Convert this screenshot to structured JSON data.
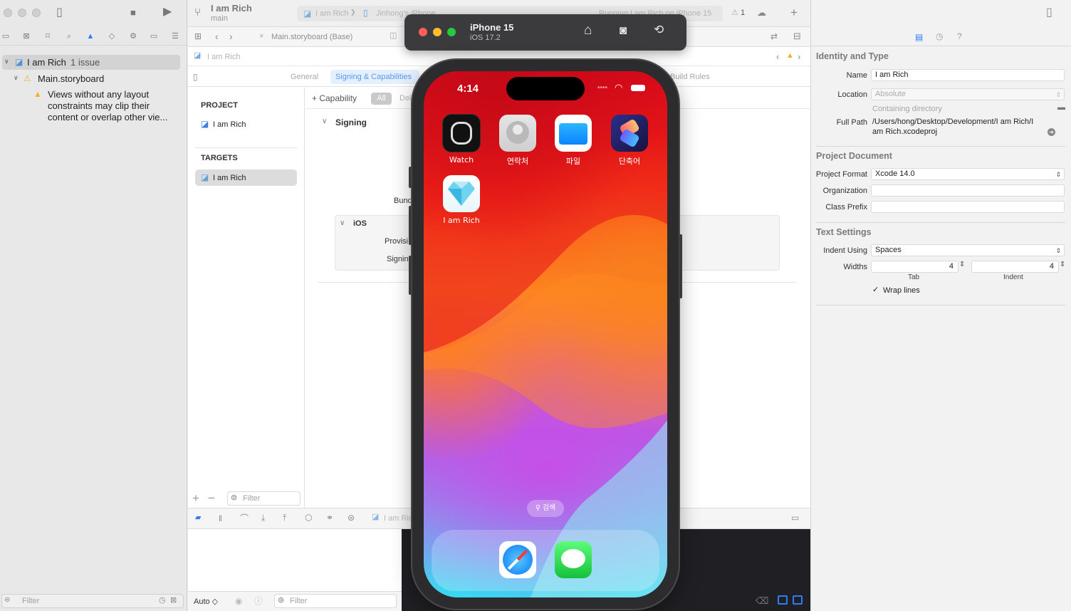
{
  "window": {
    "project_name": "I am Rich",
    "branch": "main",
    "scheme": "I am Rich",
    "destination": "Jinhong's iPhone",
    "status": "Running I am Rich on iPhone 15",
    "issue_count": "1"
  },
  "navigator": {
    "root_label": "I am Rich",
    "root_issues": "1 issue",
    "storyboard": "Main.storyboard",
    "warning": [
      "Views without any layout",
      "constraints may clip their",
      "content or overlap other vie..."
    ],
    "filter_placeholder": "Filter"
  },
  "editor": {
    "tab_label": "Main.storyboard (Base)",
    "jump_item": "I am Rich",
    "tabs": [
      "General",
      "Signing & Capabilities",
      "Build Rules"
    ],
    "active_tab": "Signing & Capabilities",
    "project_header": "PROJECT",
    "project_item": "I am Rich",
    "targets_header": "TARGETS",
    "target_item": "I am Rich",
    "capability_button": "+ Capability",
    "all_filter": "All",
    "debug_filter": "Del",
    "signing_title": "Signing",
    "bundle_label": "Bund",
    "ios_title": "iOS",
    "provision_label": "Provisi",
    "signing_label": "Signin",
    "list_filter_placeholder": "Filter",
    "debug_target": "I am Ric",
    "auto_label": "Auto ◇",
    "console_filter_placeholder": "Filter"
  },
  "inspector": {
    "identity_title": "Identity and Type",
    "name_label": "Name",
    "name_value": "I am Rich",
    "location_label": "Location",
    "location_value": "Absolute",
    "containing_directory": "Containing directory",
    "full_path_label": "Full Path",
    "full_path_value": [
      "/Users/hong/Desktop/Development/I am Rich/I",
      "am Rich.xcodeproj"
    ],
    "document_title": "Project Document",
    "format_label": "Project Format",
    "format_value": "Xcode 14.0",
    "organization_label": "Organization",
    "class_prefix_label": "Class Prefix",
    "text_title": "Text Settings",
    "indent_label": "Indent Using",
    "indent_value": "Spaces",
    "widths_label": "Widths",
    "tab_width": "4",
    "indent_width": "4",
    "tab_caption": "Tab",
    "indent_caption": "Indent",
    "wrap_label": "Wrap lines"
  },
  "simulator": {
    "device": "iPhone 15",
    "os": "iOS 17.2",
    "time": "4:14",
    "apps": [
      {
        "label": "Watch"
      },
      {
        "label": "연락처"
      },
      {
        "label": "파일"
      },
      {
        "label": "단축어"
      },
      {
        "label": "I am Rich"
      }
    ],
    "search_label": "⚲ 검색"
  },
  "colors": {
    "accent": "#2f7cf6",
    "warning": "#f0b429",
    "simulator_bar": "#3b3b3d"
  }
}
